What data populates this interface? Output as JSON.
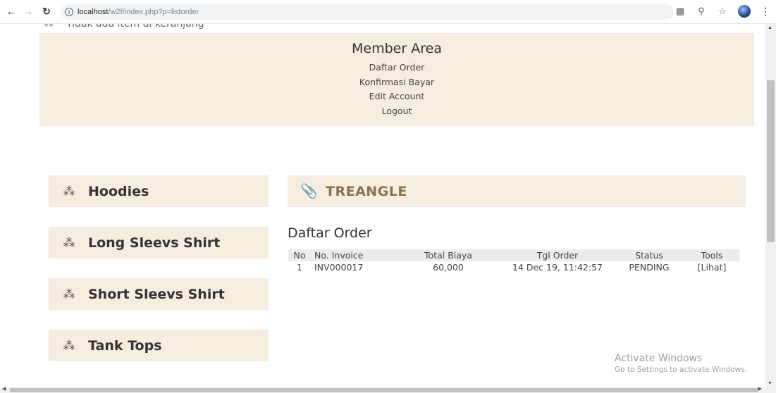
{
  "browser": {
    "url_host": "localhost",
    "url_path": "/w2f/index.php?p=listorder"
  },
  "cart": {
    "message": "Tidak ada item di keranjang"
  },
  "member_area": {
    "title": "Member Area",
    "links": [
      "Daftar Order",
      "Konfirmasi Bayar",
      "Edit Account",
      "Logout"
    ]
  },
  "sidebar": {
    "items": [
      {
        "label": "Hoodies"
      },
      {
        "label": "Long Sleevs Shirt"
      },
      {
        "label": "Short Sleevs Shirt"
      },
      {
        "label": "Tank Tops"
      }
    ]
  },
  "brand": "TREANGLE",
  "orders": {
    "title": "Daftar Order",
    "columns": [
      "No",
      "No. Invoice",
      "Total Biaya",
      "Tgl Order",
      "Status",
      "Tools"
    ],
    "rows": [
      {
        "no": "1",
        "invoice": "INV000017",
        "total": "60,000",
        "date": "14 Dec 19, 11:42:57",
        "status": "PENDING",
        "tools": "[Lihat]"
      }
    ]
  },
  "watermark": {
    "line1": "Activate Windows",
    "line2": "Go to Settings to activate Windows."
  }
}
